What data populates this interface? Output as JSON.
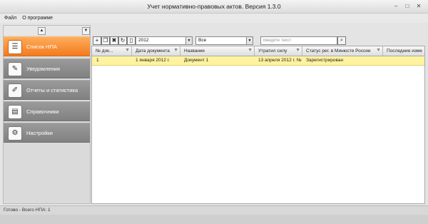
{
  "window": {
    "title": "Учет нормативно-правовых актов. Версия 1.3.0"
  },
  "menu": [
    {
      "label": "Файл"
    },
    {
      "label": "О программе"
    }
  ],
  "sidebar": {
    "items": [
      {
        "label": "Список НПА",
        "icon": "document-list-icon",
        "active": true
      },
      {
        "label": "Уведомления",
        "icon": "notification-icon"
      },
      {
        "label": "Отчеты и статистика",
        "icon": "report-icon"
      },
      {
        "label": "Справочники",
        "icon": "book-icon"
      },
      {
        "label": "Настройки",
        "icon": "gears-icon"
      }
    ]
  },
  "toolbar": {
    "year_value": "2012",
    "status_value": "Все",
    "search_placeholder": "Введите текст"
  },
  "table": {
    "columns": [
      {
        "label": "№ док..."
      },
      {
        "label": "Дата документа"
      },
      {
        "label": "Название"
      },
      {
        "label": "Утратил силу"
      },
      {
        "label": "Статус рег. в Минюсте России"
      },
      {
        "label": "Последние изме"
      }
    ],
    "rows": [
      {
        "num": "1",
        "date": "1 января 2012 г.",
        "name": "Документ 1",
        "lost_force": "13 апреля 2012 г. №",
        "status": "Зарегистрирован",
        "last_change": ""
      }
    ]
  },
  "status": {
    "text": "Готово - Всего НПА: 1"
  },
  "colors": {
    "active_nav": "#f27b1f",
    "selected_row": "#fff3a0",
    "nav_bg": "#8c8c8c"
  }
}
